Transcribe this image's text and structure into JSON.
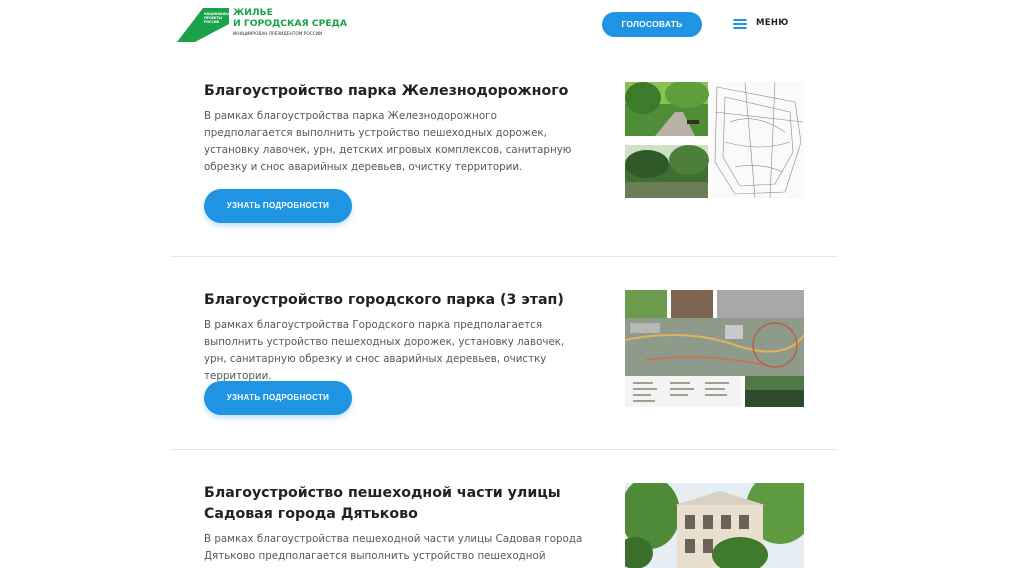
{
  "header": {
    "logo_tiny": "НАЦИОНАЛЬНЫЕ ПРОЕКТЫ РОССИИ",
    "logo_title_1": "ЖИЛЬЕ",
    "logo_title_2": "И ГОРОДСКАЯ СРЕДА",
    "logo_sub": "ИНИЦИИРОВАН ПРЕЗИДЕНТОМ РОССИИ",
    "vote_label": "ГОЛОСОВАТЬ",
    "menu_label": "МЕНЮ"
  },
  "colors": {
    "accent": "#1f94e3",
    "brand_green": "#19a24a"
  },
  "projects": [
    {
      "title": "Благоустройство парка Железнодорожного",
      "description": "В рамках благоустройства парка Железнодорожного предполагается выполнить устройство пешеходных дорожек, установку лавочек, урн, детских игровых комплексов, санитарную обрезку и снос аварийных деревьев, очистку территории.",
      "button": "УЗНАТЬ ПОДРОБНОСТИ"
    },
    {
      "title": "Благоустройство городского парка (3 этап)",
      "description": "В рамках благоустройства Городского парка предполагается выполнить устройство пешеходных дорожек, установку лавочек, урн, санитарную обрезку и снос аварийных деревьев, очистку территории.",
      "button": "УЗНАТЬ ПОДРОБНОСТИ"
    },
    {
      "title": "Благоустройство пешеходной части улицы Садовая города Дятьково",
      "description": "В рамках благоустройства пешеходной части улицы Садовая города Дятьково предполагается выполнить устройство пешеходной дорожки."
    }
  ]
}
